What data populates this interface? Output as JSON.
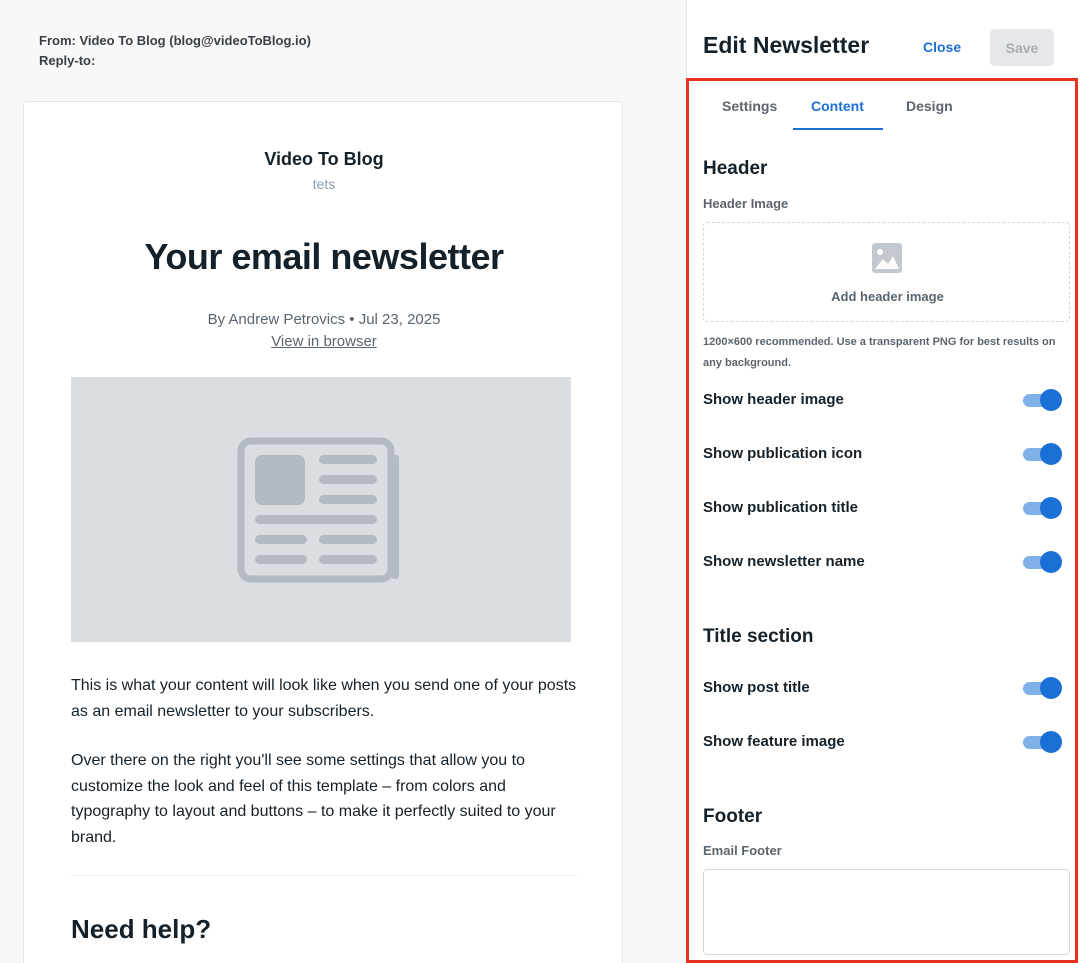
{
  "email": {
    "from_line": "From: Video To Blog (blog@videoToBlog.io)",
    "reply_to_line": "Reply-to:",
    "publication_title": "Video To Blog",
    "newsletter_name": "tets",
    "post_title": "Your email newsletter",
    "byline": "By Andrew Petrovics • Jul 23, 2025",
    "view_in_browser": "View in browser",
    "paragraph_1": "This is what your content will look like when you send one of your posts as an email newsletter to your subscribers.",
    "paragraph_2": "Over there on the right you'll see some settings that allow you to customize the look and feel of this template – from colors and typography to layout and buttons – to make it perfectly suited to your brand.",
    "help_heading": "Need help?",
    "feature_image_icon": "newspaper-icon"
  },
  "panel": {
    "title": "Edit Newsletter",
    "close_label": "Close",
    "save_label": "Save",
    "tabs": [
      {
        "label": "Settings"
      },
      {
        "label": "Content"
      },
      {
        "label": "Design"
      }
    ],
    "active_tab": "Content",
    "header_section": {
      "title": "Header",
      "image_label": "Header Image",
      "upload_label": "Add header image",
      "upload_icon": "image-icon",
      "hint": "1200×600 recommended. Use a transparent PNG for best results on any background."
    },
    "toggles": [
      {
        "label": "Show header image",
        "on": true
      },
      {
        "label": "Show publication icon",
        "on": true
      },
      {
        "label": "Show publication title",
        "on": true
      },
      {
        "label": "Show newsletter name",
        "on": true
      }
    ],
    "title_section": {
      "title": "Title section",
      "toggles": [
        {
          "label": "Show post title",
          "on": true
        },
        {
          "label": "Show feature image",
          "on": true
        }
      ]
    },
    "footer_section": {
      "title": "Footer",
      "field_label": "Email Footer",
      "value": ""
    },
    "colors": {
      "accent": "#1b70d6",
      "highlight_border": "#e8321e"
    }
  }
}
